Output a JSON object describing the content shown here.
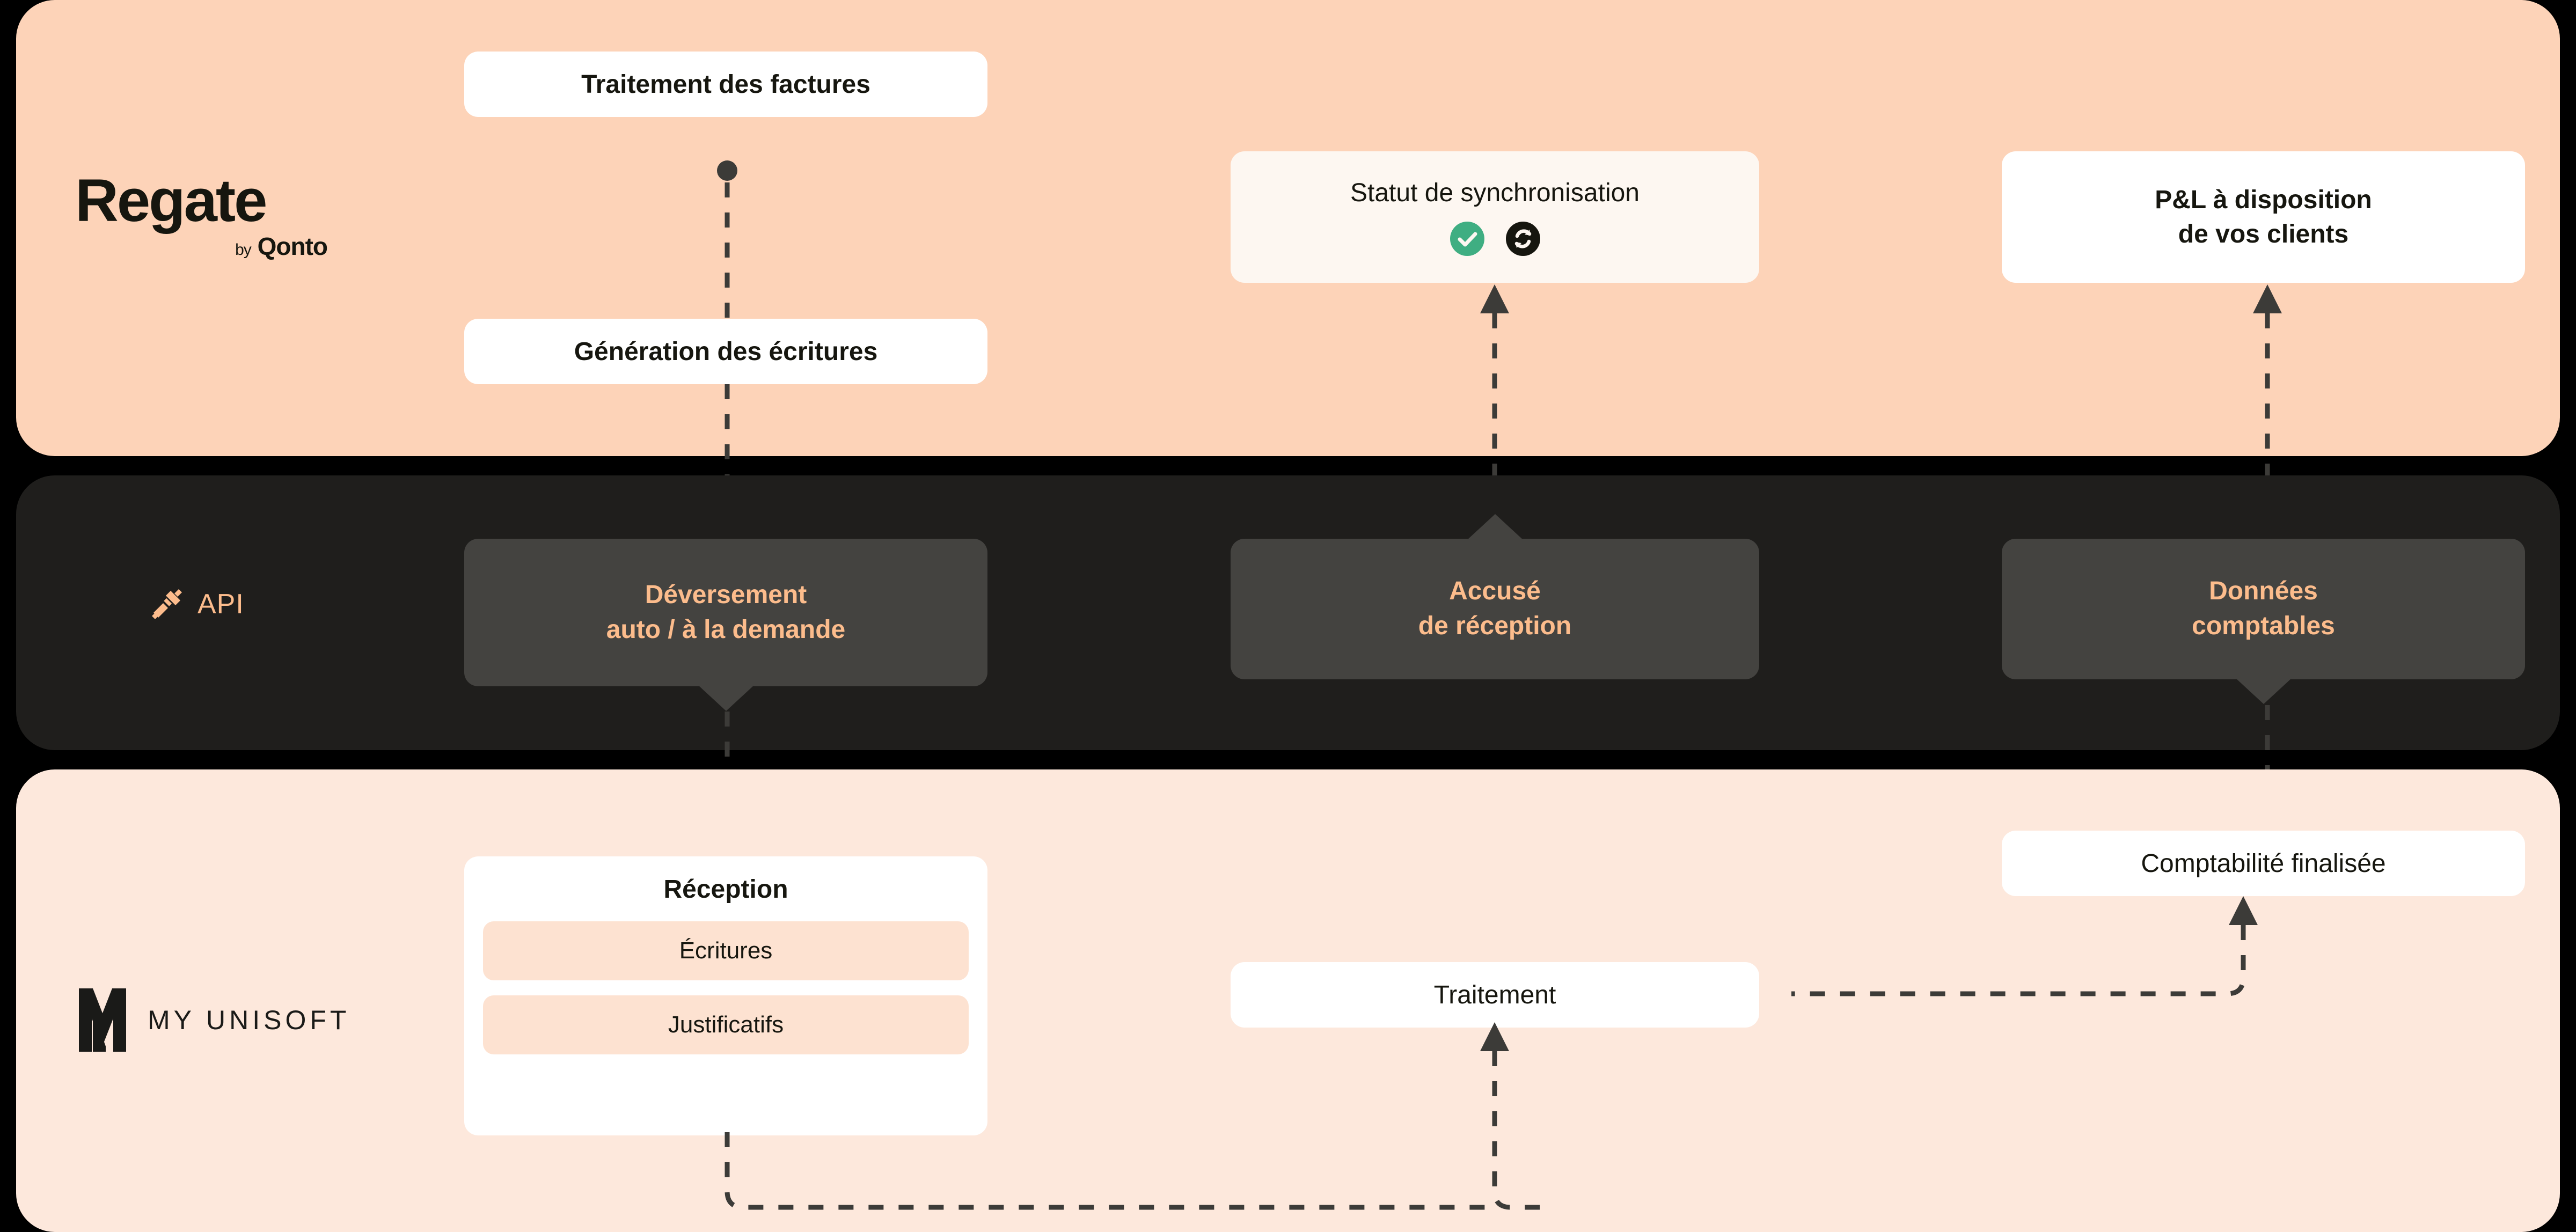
{
  "diagram": {
    "title": "Regate by Qonto / MY UNISOFT integration flow",
    "colors": {
      "band_regate_bg": "#FDD3B8",
      "band_api_bg": "#1F1E1C",
      "band_unisoft_bg": "#FDE8DC",
      "page_bg": "#000000",
      "accent_peach": "#FCBC8C",
      "card_dark": "#444340",
      "card_white": "#FFFFFF",
      "card_cream": "#FDF7F1",
      "card_peach": "#FDE2D1",
      "success_green": "#3FAE82",
      "line": "#3C3B38",
      "text_dark": "#16160F"
    }
  },
  "bands": {
    "regate": {
      "name": "Regate",
      "logo": {
        "word": "Regate",
        "by": "by",
        "brand": "Qonto"
      },
      "cards": {
        "traitement_factures": {
          "label": "Traitement des factures"
        },
        "generation_ecritures": {
          "label": "Génération des écritures"
        },
        "statut_sync": {
          "label": "Statut de synchronisation",
          "icons": [
            "check-circle-icon",
            "sync-refresh-icon"
          ]
        },
        "pl_clients": {
          "line1": "P&L à disposition",
          "line2": "de vos clients"
        }
      }
    },
    "api": {
      "name": "API",
      "label": "API",
      "icon": "api-plug-icon",
      "cards": {
        "deversement": {
          "line1": "Déversement",
          "line2": "auto / à la demande"
        },
        "accuse_reception": {
          "line1": "Accusé",
          "line2": "de réception"
        },
        "donnees_comptables": {
          "line1": "Données",
          "line2": "comptables"
        }
      }
    },
    "unisoft": {
      "name": "MY UNISOFT",
      "logo": {
        "text": "MY UNISOFT",
        "mark": "unisoft-m-mark-icon"
      },
      "cards": {
        "reception": {
          "label": "Réception",
          "items": [
            {
              "label": "Écritures"
            },
            {
              "label": "Justificatifs"
            }
          ]
        },
        "traitement": {
          "label": "Traitement"
        },
        "comptabilite_finalisee": {
          "label": "Comptabilité finalisée"
        }
      }
    }
  }
}
